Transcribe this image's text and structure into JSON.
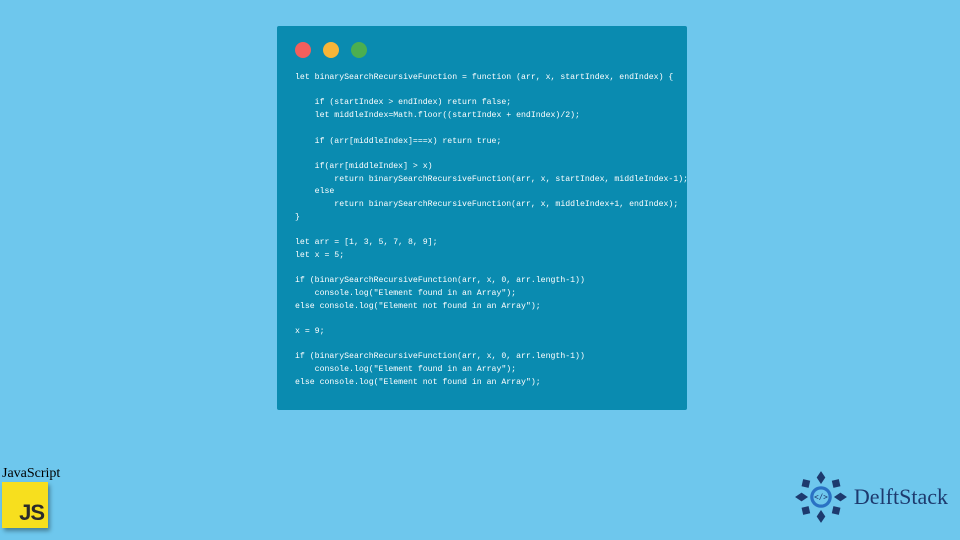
{
  "code_lines": [
    "let binarySearchRecursiveFunction = function (arr, x, startIndex, endIndex) {",
    "",
    "    if (startIndex > endIndex) return false;",
    "    let middleIndex=Math.floor((startIndex + endIndex)/2);",
    "",
    "    if (arr[middleIndex]===x) return true;",
    "",
    "    if(arr[middleIndex] > x)",
    "        return binarySearchRecursiveFunction(arr, x, startIndex, middleIndex-1);",
    "    else",
    "        return binarySearchRecursiveFunction(arr, x, middleIndex+1, endIndex);",
    "}",
    "",
    "let arr = [1, 3, 5, 7, 8, 9];",
    "let x = 5;",
    "",
    "if (binarySearchRecursiveFunction(arr, x, 0, arr.length-1))",
    "    console.log(\"Element found in an Array\");",
    "else console.log(\"Element not found in an Array\");",
    "",
    "x = 9;",
    "",
    "if (binarySearchRecursiveFunction(arr, x, 0, arr.length-1))",
    "    console.log(\"Element found in an Array\");",
    "else console.log(\"Element not found in an Array\");"
  ],
  "js_badge": {
    "label": "JavaScript",
    "logo_text": "JS"
  },
  "brand": {
    "name": "DelftStack"
  },
  "colors": {
    "page_bg": "#6ec7ed",
    "window_bg": "#0a8bb0",
    "js_yellow": "#f7df1e",
    "brand_blue": "#1d3a6e"
  }
}
